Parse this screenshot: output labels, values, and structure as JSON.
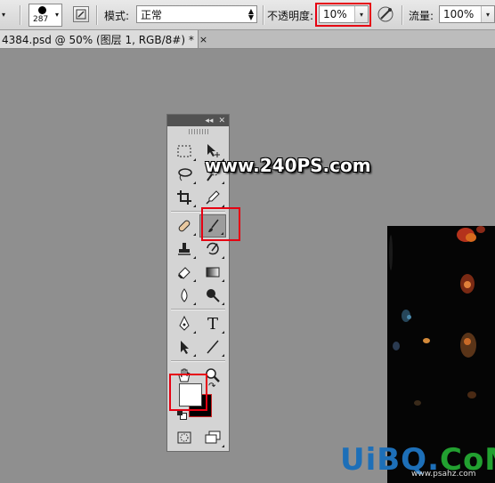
{
  "options_bar": {
    "brush_size": "287",
    "mode_label": "模式:",
    "mode_value": "正常",
    "opacity_label": "不透明度:",
    "opacity_value": "10%",
    "flow_label": "流量:",
    "flow_value": "100%"
  },
  "document_tab": {
    "title": "4384.psd @ 50% (图层 1, RGB/8#) *",
    "close": "×"
  },
  "tools_panel": {
    "collapse": "◂◂",
    "close": "✕",
    "type_tool_glyph": "T",
    "active_tool": "brush-tool",
    "foreground_color": "#ffffff",
    "background_color": "#000000"
  },
  "watermarks": {
    "site": "www.240PS.com",
    "logo_part1": "UiBQ.",
    "logo_part2": "CoM",
    "logo_sub": "www.psahz.com"
  },
  "colors": {
    "highlight": "#e60012"
  }
}
